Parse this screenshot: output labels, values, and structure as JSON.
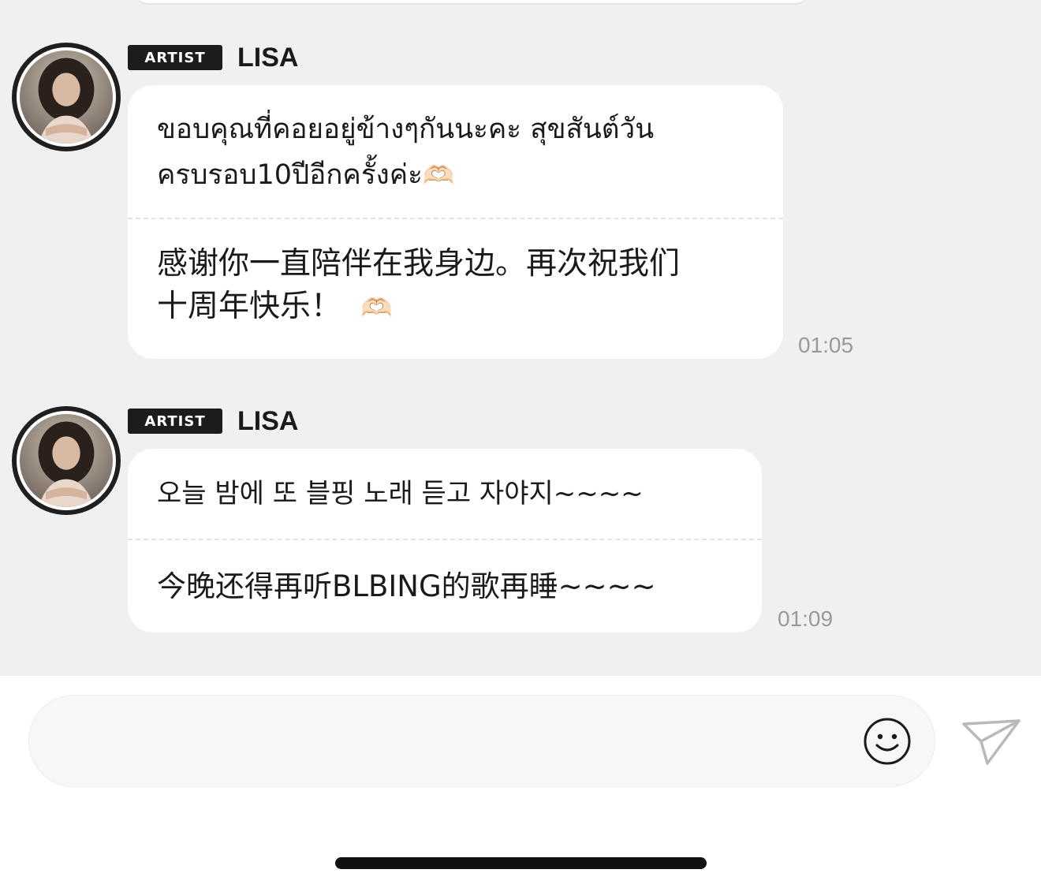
{
  "messages": [
    {
      "badge": "ARTIST",
      "sender": "LISA",
      "parts": [
        {
          "lines": [
            "ขอบคุณที่คอยอยู่ข้างๆกันนะคะ สุขสันต์วัน",
            "ครบรอบ10ปีอีกครั้งค่ะ"
          ],
          "emoji": "🫶🏻"
        },
        {
          "lines": [
            "感谢你一直陪伴在我身边。再次祝我们",
            "十周年快乐！"
          ],
          "emoji": "🫶🏻"
        }
      ],
      "time": "01:05"
    },
    {
      "badge": "ARTIST",
      "sender": "LISA",
      "parts": [
        {
          "lines": [
            "오늘 밤에 또 블핑 노래 듣고 자야지~~~~"
          ]
        },
        {
          "lines": [
            "今晚还得再听BLBING的歌再睡~~~~"
          ]
        }
      ],
      "time": "01:09"
    }
  ],
  "input": {
    "value": "",
    "placeholder": ""
  },
  "icons": {
    "emoji": "smiley-face-icon",
    "send": "paper-plane-icon"
  },
  "colors": {
    "chat_background": "#f0f0f0",
    "badge_background": "#1c1c1c",
    "bubble": "#ffffff",
    "timestamp": "#9a9a9a"
  }
}
